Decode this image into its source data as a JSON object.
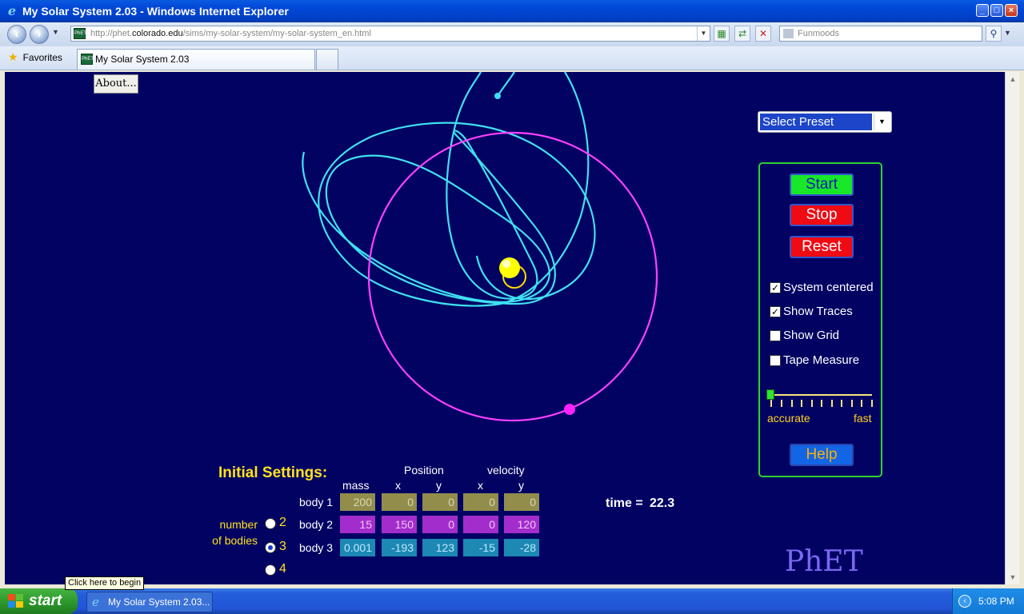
{
  "window": {
    "title": "My Solar System 2.03 - Windows Internet Explorer",
    "url_prefix": "http://phet.",
    "url_host": "colorado.edu",
    "url_path": "/sims/my-solar-system/my-solar-system_en.html",
    "search_placeholder": "Funmoods",
    "favorites_label": "Favorites",
    "tab_title": "My Solar System 2.03"
  },
  "sim": {
    "about_label": "About...",
    "preset_label": "Select Preset",
    "buttons": {
      "start": "Start",
      "stop": "Stop",
      "reset": "Reset",
      "help": "Help"
    },
    "options": [
      {
        "label": "System centered",
        "checked": true
      },
      {
        "label": "Show Traces",
        "checked": true
      },
      {
        "label": "Show Grid",
        "checked": false
      },
      {
        "label": "Tape Measure",
        "checked": false
      }
    ],
    "slider": {
      "left_label": "accurate",
      "right_label": "fast",
      "value_fraction": 0.0
    },
    "initial_settings": {
      "title": "Initial Settings:",
      "group_position": "Position",
      "group_velocity": "velocity",
      "columns": [
        "mass",
        "x",
        "y",
        "x",
        "y"
      ],
      "rows": [
        {
          "label": "body 1",
          "values": [
            "200",
            "0",
            "0",
            "0",
            "0"
          ]
        },
        {
          "label": "body 2",
          "values": [
            "15",
            "150",
            "0",
            "0",
            "120"
          ]
        },
        {
          "label": "body 3",
          "values": [
            "0.001",
            "-193",
            "123",
            "-15",
            "-28"
          ]
        }
      ]
    },
    "number_of_bodies": {
      "label_line1": "number",
      "label_line2": "of bodies",
      "options": [
        "2",
        "3",
        "4"
      ],
      "selected": "3"
    },
    "time_label": "time =",
    "time_value": "22.3",
    "logo": "PhET",
    "colors": {
      "background": "#020263",
      "body1": "#ffff00",
      "body2": "#ff22ff",
      "body3": "#40e0f0",
      "panel_border": "#2fd12f"
    }
  },
  "tooltip": "Click here to begin",
  "taskbar": {
    "start_label": "start",
    "task_item": "My Solar System 2.03...",
    "clock": "5:08 PM"
  }
}
